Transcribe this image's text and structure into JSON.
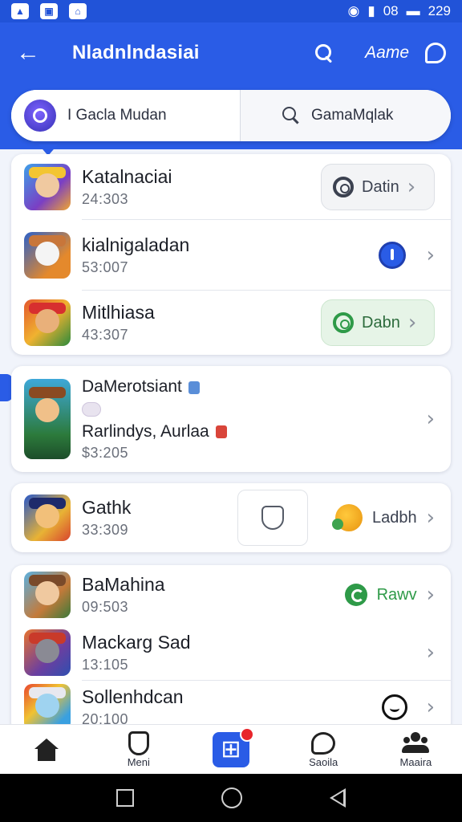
{
  "status": {
    "carrier": "08",
    "time": "229"
  },
  "appbar": {
    "title": "Nladnlndasiai",
    "account_label": "Aame",
    "back_icon": "arrow-left-icon",
    "search_icon": "search-icon",
    "chat_icon": "chat-bubble-icon"
  },
  "segments": {
    "left_label": "I Gacla Mudan",
    "right_label": "GamaMqlak"
  },
  "colors": {
    "primary": "#2a5ce6",
    "green": "#2e9a48",
    "badge_red": "#e8252b"
  },
  "card1": {
    "items": [
      {
        "name": "Katalnaciai",
        "sub": "24:303",
        "action": "Datin"
      },
      {
        "name": "kialnigaladan",
        "sub": "53:007"
      },
      {
        "name": "Mitlhiasa",
        "sub": "43:307",
        "action": "Dabn"
      }
    ]
  },
  "card2": {
    "name": "DaMerotsiant",
    "name2": "Rarlindys, Aurlaa",
    "sub": "$3:205"
  },
  "card3": {
    "name": "Gathk",
    "sub": "33:309",
    "action": "Ladbh"
  },
  "card4": {
    "items": [
      {
        "name": "BaMahina",
        "sub": "09:503",
        "action": "Rawv"
      },
      {
        "name": "Mackarg Sad",
        "sub": "13:105"
      },
      {
        "name": "Sollenhdcan",
        "sub": "20:100"
      }
    ]
  },
  "bottom_nav": [
    {
      "label": "",
      "icon": "home-icon"
    },
    {
      "label": "Meni",
      "icon": "shield-icon"
    },
    {
      "label": "",
      "icon": "center-plus-icon"
    },
    {
      "label": "Saoila",
      "icon": "heart-chat-icon"
    },
    {
      "label": "Maaira",
      "icon": "people-icon"
    }
  ]
}
